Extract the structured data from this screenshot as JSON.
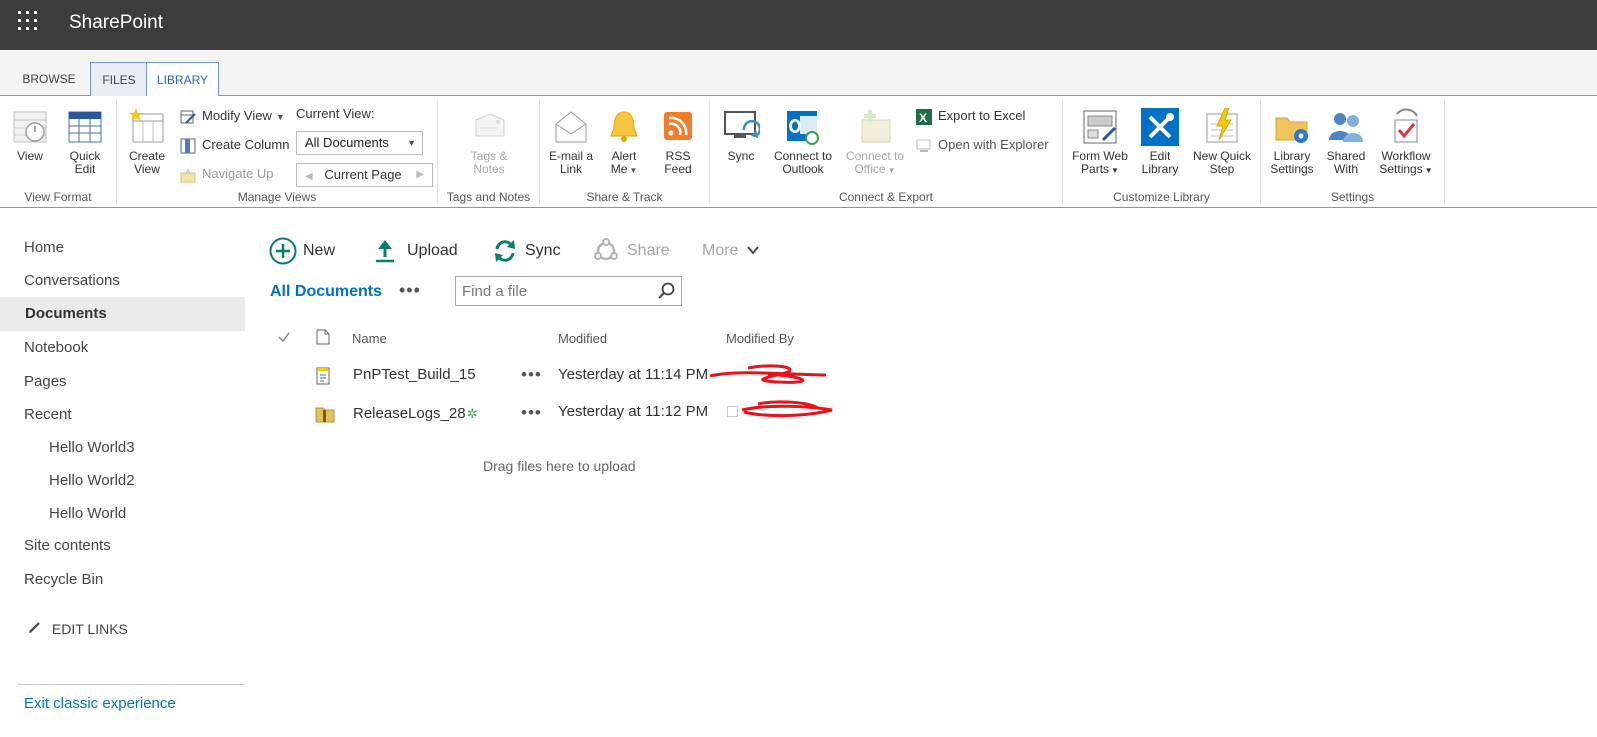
{
  "app": {
    "brand": "SharePoint"
  },
  "ribbon": {
    "tabs": [
      "BROWSE",
      "FILES",
      "LIBRARY"
    ],
    "view_format": {
      "label": "View Format",
      "view": "View",
      "quick_edit": "Quick Edit"
    },
    "manage_views": {
      "label": "Manage Views",
      "create_view": "Create View",
      "modify_view": "Modify View",
      "create_column": "Create Column",
      "navigate_up": "Navigate Up",
      "current_view_label": "Current View:",
      "current_view_value": "All Documents",
      "current_page": "Current Page"
    },
    "tags_notes": {
      "label": "Tags and Notes",
      "button": "Tags & Notes"
    },
    "share_track": {
      "label": "Share & Track",
      "email": "E-mail a Link",
      "alert": "Alert Me",
      "rss": "RSS Feed"
    },
    "connect_export": {
      "label": "Connect & Export",
      "sync": "Sync",
      "connect_outlook": "Connect to Outlook",
      "connect_office": "Connect to Office",
      "export_excel": "Export to Excel",
      "open_explorer": "Open with Explorer"
    },
    "customize": {
      "label": "Customize Library",
      "form_web_parts": "Form Web Parts",
      "edit_library": "Edit Library",
      "new_quick_step": "New Quick Step"
    },
    "settings": {
      "label": "Settings",
      "library_settings": "Library Settings",
      "shared_with": "Shared With",
      "workflow_settings": "Workflow Settings"
    }
  },
  "left_nav": {
    "items": [
      "Home",
      "Conversations",
      "Documents",
      "Notebook",
      "Pages",
      "Recent"
    ],
    "recent_items": [
      "Hello World3",
      "Hello World2",
      "Hello World"
    ],
    "bottom_items": [
      "Site contents",
      "Recycle Bin"
    ],
    "edit_links": "EDIT LINKS",
    "exit": "Exit classic experience"
  },
  "commands": {
    "new": "New",
    "upload": "Upload",
    "sync": "Sync",
    "share": "Share",
    "more": "More"
  },
  "view": {
    "name": "All Documents",
    "more": "•••"
  },
  "search": {
    "placeholder": "Find a file"
  },
  "table": {
    "headers": {
      "name": "Name",
      "modified": "Modified",
      "modified_by": "Modified By"
    },
    "rows": [
      {
        "name": "PnPTest_Build_15",
        "modified": "Yesterday at 11:14 PM",
        "more": "•••"
      },
      {
        "name": "ReleaseLogs_28",
        "modified": "Yesterday at 11:12 PM",
        "more": "•••"
      }
    ],
    "drop_hint": "Drag files here to upload"
  },
  "colors": {
    "accent": "#0072c6",
    "suite_bar": "#3c3c3c",
    "ribbon_border": "#6e9bd8"
  }
}
